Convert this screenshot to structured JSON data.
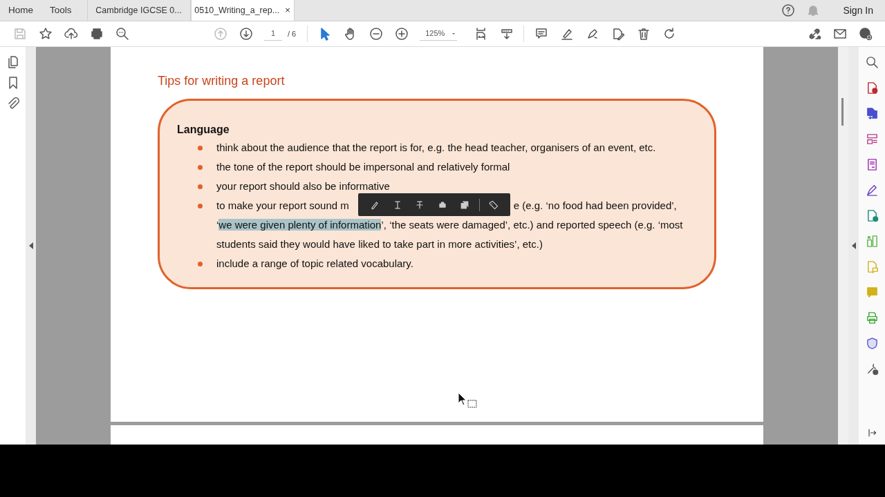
{
  "top_tabs": [
    {
      "label": "Home",
      "selected": false
    },
    {
      "label": "Tools",
      "selected": false
    }
  ],
  "doc_tabs": [
    {
      "label": "Cambridge IGCSE 0...",
      "selected": false,
      "closable": false
    },
    {
      "label": "0510_Writing_a_rep...",
      "selected": true,
      "closable": true
    }
  ],
  "close_glyph": "×",
  "sign_in": "Sign In",
  "page_field": {
    "value": "1",
    "total": "/ 6"
  },
  "zoom_field": {
    "value": "125%"
  },
  "document": {
    "heading": "Tips for writing a report",
    "box_title": "Language",
    "bullets": [
      {
        "kind": "plain",
        "text": "think about the audience that the report is for, e.g. the head teacher, organisers of an event, etc."
      },
      {
        "kind": "plain",
        "text": "the tone of the report should be impersonal and relatively formal"
      },
      {
        "kind": "plain",
        "text": "your report should also be informative"
      },
      {
        "kind": "covered",
        "before": "to make your report sound m",
        "after": "e (e.g. ‘no food had been provided’,",
        "quote_open": "‘",
        "highlight": "we were given plenty of information",
        "rest": "’, ‘the seats were damaged’, etc.) and reported speech (e.g. ‘most students said they would have liked to take part in more activities’, etc.)"
      },
      {
        "kind": "plain",
        "text": "include a range of topic related vocabulary."
      }
    ]
  }
}
